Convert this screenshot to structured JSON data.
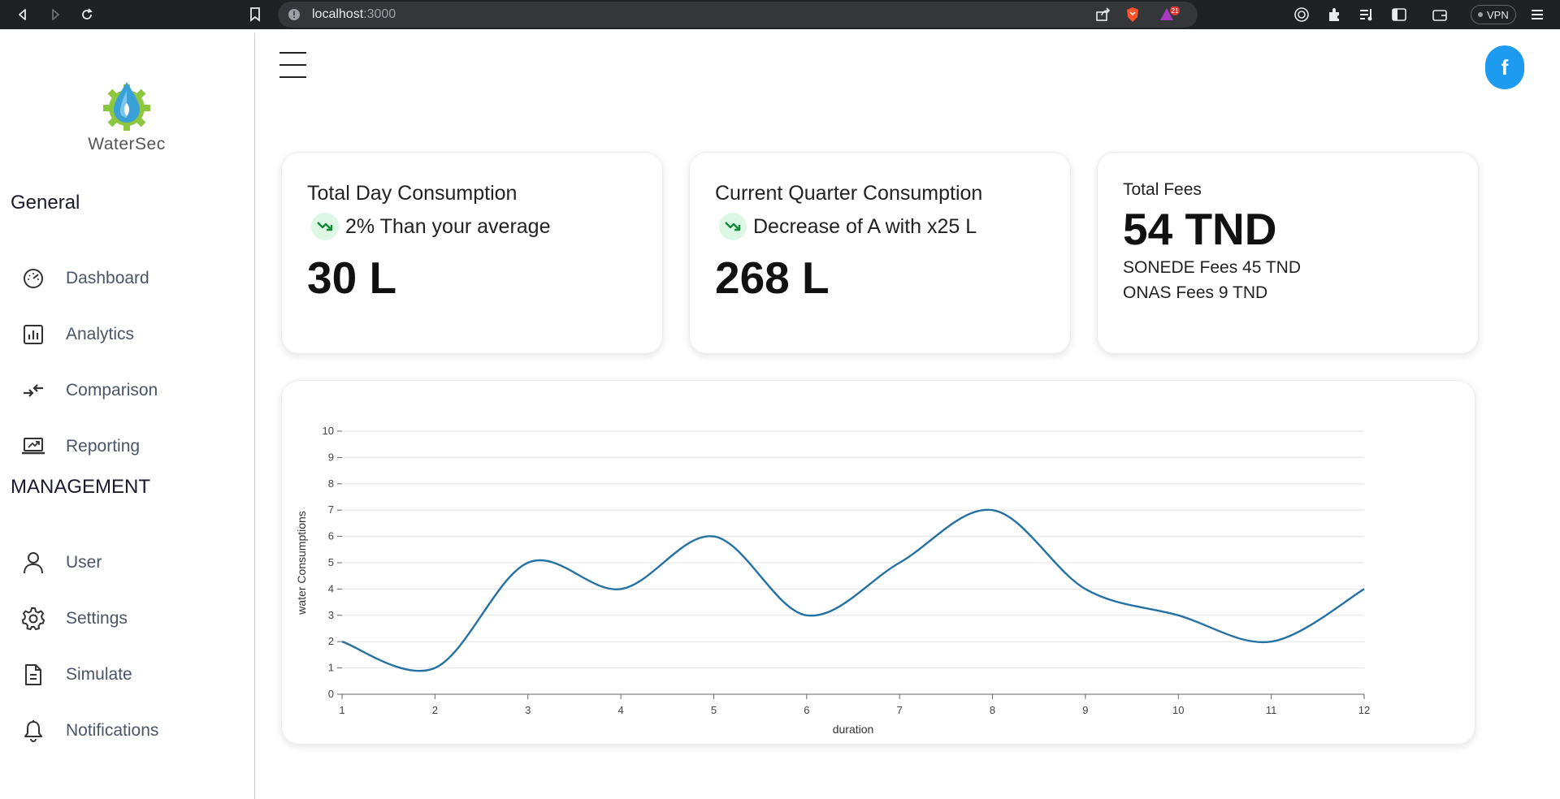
{
  "browser": {
    "url_host": "localhost",
    "url_port": ":3000",
    "vpn_label": "VPN",
    "notification_count": "21"
  },
  "sidebar": {
    "logo_text": "WaterSec",
    "sections": [
      {
        "title": "General",
        "items": [
          {
            "label": "Dashboard",
            "icon": "gauge-icon"
          },
          {
            "label": "Analytics",
            "icon": "bar-chart-icon"
          },
          {
            "label": "Comparison",
            "icon": "compare-arrows-icon"
          },
          {
            "label": "Reporting",
            "icon": "laptop-trend-icon"
          }
        ]
      },
      {
        "title": "MANAGEMENT",
        "items": [
          {
            "label": "User",
            "icon": "user-icon"
          },
          {
            "label": "Settings",
            "icon": "gear-icon"
          },
          {
            "label": "Simulate",
            "icon": "document-icon"
          },
          {
            "label": "Notifications",
            "icon": "bell-icon"
          }
        ]
      }
    ]
  },
  "header": {
    "avatar_letter": "f"
  },
  "cards": {
    "day": {
      "title": "Total Day Consumption",
      "trend_text": "2% Than your average",
      "value": "30 L"
    },
    "quarter": {
      "title": "Current Quarter Consumption",
      "trend_text": "Decrease of A with x25 L",
      "value": "268 L"
    },
    "fees": {
      "title": "Total Fees",
      "value": "54 TND",
      "sonede": "SONEDE Fees 45 TND",
      "onas": "ONAS Fees 9 TND"
    }
  },
  "colors": {
    "line": "#2471a3",
    "trend_green": "#138a36",
    "trend_bg": "#dcf7e4",
    "facebook": "#1d9bf0"
  },
  "chart_data": {
    "type": "line",
    "x": [
      1,
      2,
      3,
      4,
      5,
      6,
      7,
      8,
      9,
      10,
      11,
      12
    ],
    "values": [
      2,
      1,
      5,
      4,
      6,
      3,
      5,
      7,
      4,
      3,
      2,
      4
    ],
    "xlabel": "duration",
    "ylabel": "water Consumptions",
    "ylim": [
      0,
      10
    ],
    "yticks": [
      0,
      1,
      2,
      3,
      4,
      5,
      6,
      7,
      8,
      9,
      10
    ],
    "grid": true,
    "curve": "smooth"
  }
}
